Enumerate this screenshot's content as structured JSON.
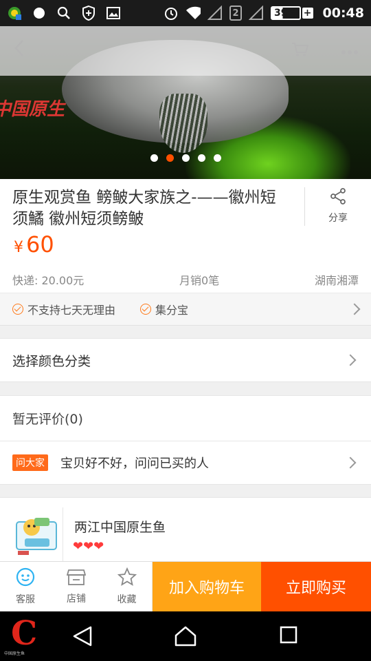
{
  "status_bar": {
    "battery": "39%",
    "time": "00:48",
    "sim_slot": "2"
  },
  "nav": {
    "back_icon": "chevron-left-icon",
    "cart_icon": "cart-icon",
    "more_icon": "more-icon"
  },
  "carousel": {
    "total": 5,
    "active_index": 1
  },
  "product": {
    "title": "原生观赏鱼 鳑鲏大家族之-——徽州短须鱊 徽州短须鳑鲏",
    "price_currency": "¥",
    "price": "60",
    "shipping": "快递: 20.00元",
    "monthly_sales": "月销0笔",
    "location": "湖南湘潭",
    "share_label": "分享"
  },
  "services": [
    "不支持七天无理由",
    "集分宝"
  ],
  "options": {
    "select_label": "选择颜色分类"
  },
  "reviews": {
    "label": "暂无评价(0)"
  },
  "ask": {
    "badge": "问大家",
    "text": "宝贝好不好，问问已买的人"
  },
  "shop": {
    "name": "两江中国原生鱼",
    "hearts": "❤❤❤"
  },
  "bottom_bar": {
    "service_label": "客服",
    "store_label": "店铺",
    "favorite_label": "收藏",
    "add_cart_label": "加入购物车",
    "buy_now_label": "立即购买"
  },
  "colors": {
    "accent_orange": "#ff5000",
    "cart_orange": "#ffa416",
    "price": "#ff5000"
  }
}
